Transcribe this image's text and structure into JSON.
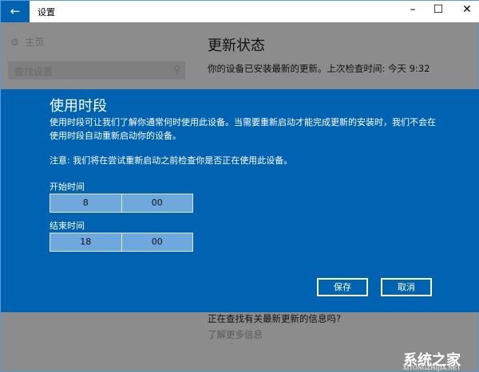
{
  "window": {
    "title": "设置",
    "back_icon": "←",
    "minimize": "–",
    "maximize": "☐",
    "close": "✕"
  },
  "sidebar": {
    "home": "主页",
    "search_placeholder": "查找设置"
  },
  "main": {
    "title": "更新状态",
    "status": "你的设备已安装最新的更新。上次检查时间: 今天 9:32",
    "question": "正在查找有关最新更新的信息吗?",
    "learn_more": "了解更多信息"
  },
  "dialog": {
    "title": "使用时段",
    "description": "使用时段可让我们了解你通常何时使用此设备。当需要重新启动才能完成更新的安装时，我们不会在使用时段自动重新启动你的设备。",
    "note": "注意: 我们将在尝试重新启动之前检查你是否正在使用此设备。",
    "start_label": "开始时间",
    "start_hour": "8",
    "start_minute": "00",
    "end_label": "结束时间",
    "end_hour": "18",
    "end_minute": "00",
    "save": "保存",
    "cancel": "取消"
  },
  "watermark": {
    "text": "系统之家",
    "url": "XITONGZHIJIA.NET"
  }
}
